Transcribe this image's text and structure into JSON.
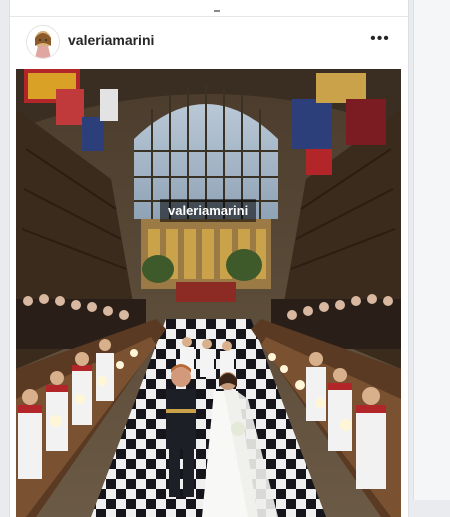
{
  "post": {
    "username": "valeriamarini",
    "more_label": "•••",
    "watermark": "valeriamarini"
  },
  "icons": {
    "avatar": "profile-photo",
    "more": "ellipsis-icon"
  },
  "colors": {
    "accent_gold": "#c9a24a",
    "carpet_white": "#f2f2f2",
    "uniform_dark": "#1d1f27",
    "choir_red": "#b2262a"
  }
}
